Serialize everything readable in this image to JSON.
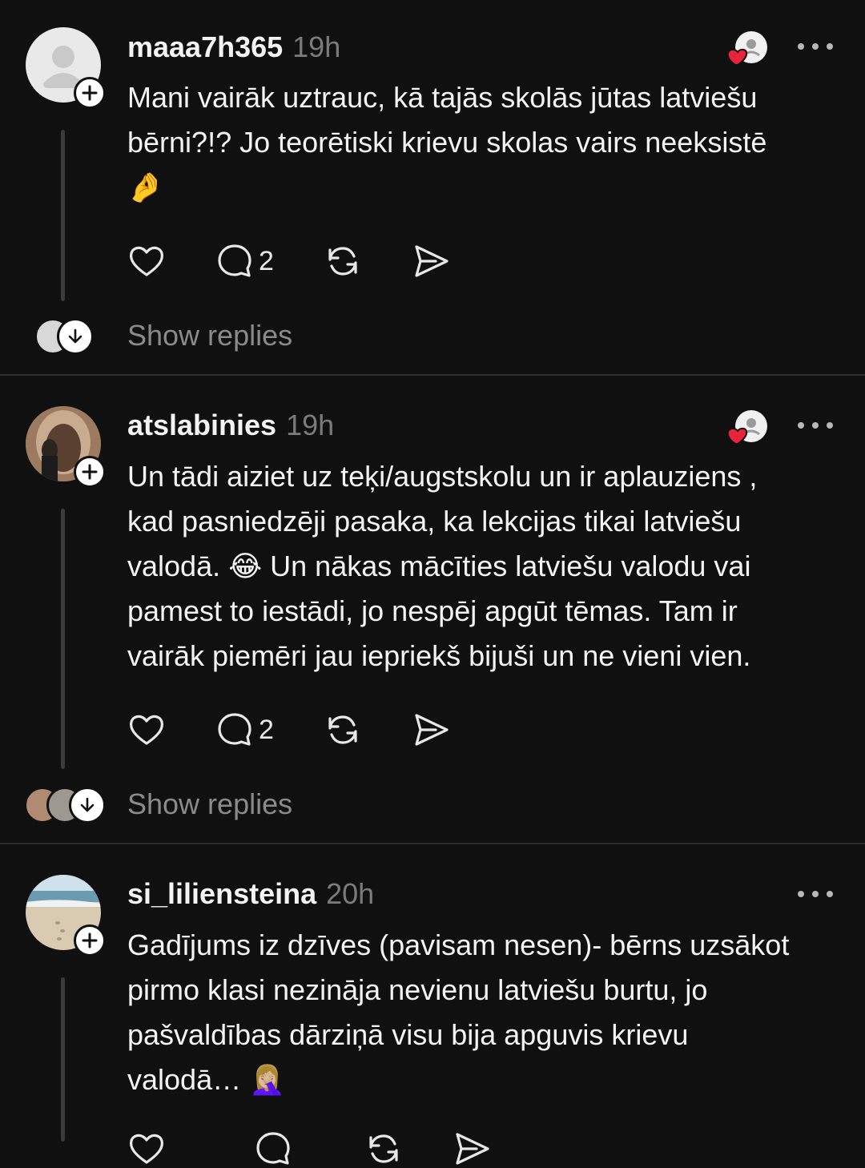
{
  "posts": [
    {
      "username": "maaa7h365",
      "time": "19h",
      "text": "Mani vairāk uztrauc, kā tajās skolās jūtas latviešu\nbērni?!? Jo teorētiski krievu skolas vairs neeksistē\n🤌",
      "reply_count": "2",
      "show_replies": "Show replies",
      "avatar": "default-avatar"
    },
    {
      "username": "atslabinies",
      "time": "19h",
      "text": "Un tādi aiziet uz teķi/augstskolu un ir aplauziens ,\nkad pasniedzēji pasaka, ka lekcijas tikai latviešu\nvalodā. 😂 Un nākas mācīties latviešu valodu vai\npamest to iestādi, jo nespēj apgūt tēmas. Tam ir\nvairāk piemēri jau iepriekš bijuši un ne vieni vien.",
      "reply_count": "2",
      "show_replies": "Show replies",
      "avatar": "photo-avatar"
    },
    {
      "username": "si_liliensteina",
      "time": "20h",
      "text": "Gadījums iz dzīves (pavisam nesen)- bērns uzsākot\npirmo klasi nezināja nevienu latviešu burtu, jo\npašvaldības dārziņā visu bija apguvis krievu\nvalodā… 🤦🏼‍♀️",
      "avatar": "beach-avatar"
    }
  ],
  "colors": {
    "background": "#101010",
    "text": "#f3f3f3",
    "muted": "#7b7b7b",
    "heart": "#e8233a"
  }
}
